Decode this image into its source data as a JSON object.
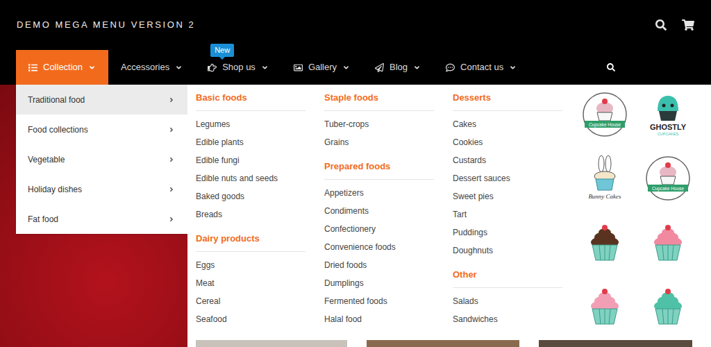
{
  "header": {
    "title": "DEMO MEGA MENU VERSION 2"
  },
  "nav": [
    {
      "label": "Collection",
      "selected": true
    },
    {
      "label": "Accessories",
      "selected": false
    },
    {
      "label": "Shop us",
      "selected": false,
      "badge": "New"
    },
    {
      "label": "Gallery",
      "selected": false
    },
    {
      "label": "Blog",
      "selected": false
    },
    {
      "label": "Contact us",
      "selected": false
    }
  ],
  "categories": [
    {
      "label": "Traditional food",
      "selected": true
    },
    {
      "label": "Food collections",
      "selected": false
    },
    {
      "label": "Vegetable",
      "selected": false
    },
    {
      "label": "Holiday dishes",
      "selected": false
    },
    {
      "label": "Fat food",
      "selected": false
    }
  ],
  "columns": [
    [
      {
        "heading": "Basic foods",
        "items": [
          "Legumes",
          "Edible plants",
          "Edible fungi",
          "Edible nuts and seeds",
          "Baked goods",
          "Breads"
        ]
      },
      {
        "heading": "Dairy products",
        "items": [
          "Eggs",
          "Meat",
          "Cereal",
          "Seafood"
        ]
      }
    ],
    [
      {
        "heading": "Staple foods",
        "items": [
          "Tuber-crops",
          "Grains"
        ]
      },
      {
        "heading": "Prepared foods",
        "items": [
          "Appetizers",
          "Condiments",
          "Confectionery",
          "Convenience foods",
          "Dried foods",
          "Dumplings",
          "Fermented foods",
          "Halal food"
        ]
      }
    ],
    [
      {
        "heading": "Desserts",
        "items": [
          "Cakes",
          "Cookies",
          "Custards",
          "Dessert sauces",
          "Sweet pies",
          "Tart",
          "Puddings",
          "Doughnuts"
        ]
      },
      {
        "heading": "Other",
        "items": [
          "Salads",
          "Sandwiches"
        ]
      }
    ]
  ],
  "logos": [
    {
      "kind": "badge",
      "label": "Cupcake House",
      "color": "#e8b7c4"
    },
    {
      "kind": "ghost",
      "label": "GHOSTLY",
      "sub": "CUPCAKES",
      "color": "#3bbfad"
    },
    {
      "kind": "bunny",
      "label": "Bunny Cakes",
      "color": "#f4e6c8"
    },
    {
      "kind": "badge",
      "label": "Cupcake House",
      "color": "#e8b7c4"
    },
    {
      "kind": "cupcake",
      "color": "#5a3320"
    },
    {
      "kind": "cupcake",
      "color": "#f18aa0"
    },
    {
      "kind": "cupcake",
      "color": "#f29fb5"
    },
    {
      "kind": "cupcake",
      "color": "#4fc1a6"
    }
  ]
}
